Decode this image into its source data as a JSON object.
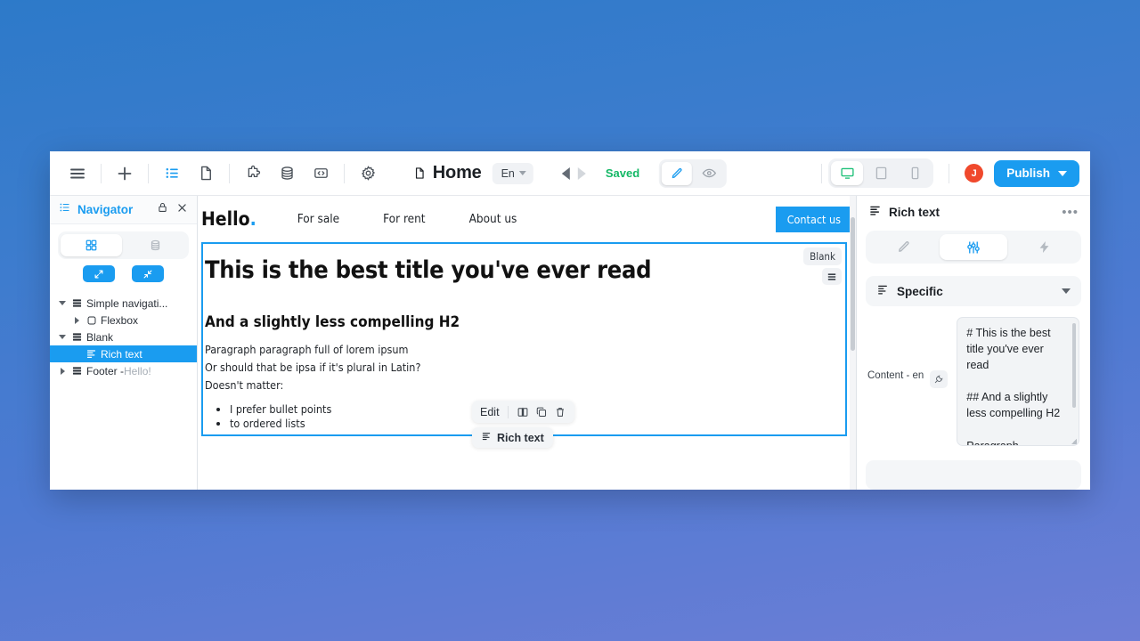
{
  "toolbar": {
    "icons": [
      {
        "name": "menu-icon",
        "label": "Menu"
      },
      {
        "name": "add-icon",
        "label": "Add"
      },
      {
        "name": "pages-list-icon",
        "label": "Pages"
      },
      {
        "name": "page-icon",
        "label": "Page"
      },
      {
        "name": "plugin-icon",
        "label": "Plugins"
      },
      {
        "name": "database-icon",
        "label": "Database"
      },
      {
        "name": "code-icon",
        "label": "Code"
      },
      {
        "name": "settings-icon",
        "label": "Settings"
      }
    ]
  },
  "header": {
    "page_title": "Home",
    "language": "En",
    "save_status": "Saved",
    "undo_label": "Undo",
    "redo_label": "Redo",
    "mode_edit": "Edit",
    "mode_preview": "Preview",
    "device_desktop": "Desktop",
    "device_tablet": "Tablet",
    "device_mobile": "Mobile",
    "avatar_initial": "J",
    "publish_label": "Publish",
    "accent": "#1a9cf0",
    "saved_color": "#14b866"
  },
  "navigator": {
    "title": "Navigator",
    "lock_label": "Lock",
    "close_label": "Close",
    "view_layers": "Layers",
    "view_data": "Data",
    "expand_all": "Expand all",
    "collapse_all": "Collapse all",
    "tree": [
      {
        "label": "Simple navigati...",
        "sub": "",
        "icon": "section-icon",
        "depth": 0,
        "twisty": "open",
        "selected": false
      },
      {
        "label": "Flexbox",
        "sub": "",
        "icon": "flexbox-icon",
        "depth": 1,
        "twisty": "closed",
        "selected": false
      },
      {
        "label": "Blank",
        "sub": "",
        "icon": "section-icon",
        "depth": 0,
        "twisty": "open",
        "selected": false
      },
      {
        "label": "Rich text",
        "sub": "",
        "icon": "rich-text-icon",
        "depth": 1,
        "twisty": "none",
        "selected": true
      },
      {
        "label": "Footer - ",
        "sub": "Hello!",
        "icon": "section-icon",
        "depth": 0,
        "twisty": "closed",
        "selected": false
      }
    ]
  },
  "canvas": {
    "site_nav": {
      "logo": "Hello",
      "logo_dot": ".",
      "links": [
        "For sale",
        "For rent",
        "About us"
      ],
      "cta": "Contact us"
    },
    "section_badge": "Blank",
    "section_menu_label": "Section options",
    "content": {
      "h1": "This is the best title you've ever read",
      "h2": "And a slightly less compelling H2",
      "paragraphs": [
        "Paragraph paragraph full of lorem ipsum",
        "Or should that be ipsa if it's plural in Latin?",
        "Doesn't matter:"
      ],
      "bullets": [
        "I prefer bullet points",
        "to ordered lists"
      ]
    },
    "float_toolbar": {
      "edit": "Edit",
      "move_label": "Move",
      "duplicate_label": "Duplicate",
      "delete_label": "Delete",
      "tag": "Rich text"
    }
  },
  "right_panel": {
    "title": "Rich text",
    "more_label": "•••",
    "tab_style": "Style",
    "tab_settings": "Settings",
    "tab_interactions": "Interactions",
    "section_title": "Specific",
    "field_label": "Content - en",
    "connect_label": "Connect to data",
    "field_value": "# This is the best title you've ever read\n\n## And a slightly less compelling H2\n\nParagraph paragraph full of"
  }
}
